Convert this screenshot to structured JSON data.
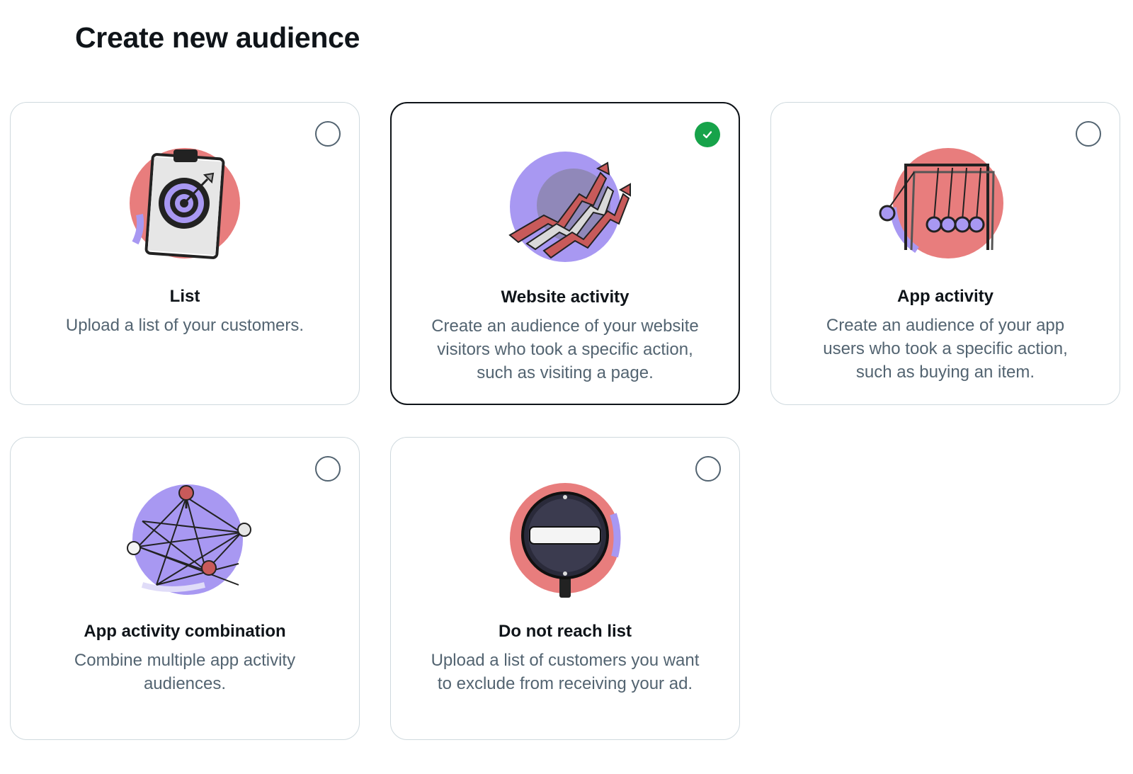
{
  "page": {
    "title": "Create new audience"
  },
  "colors": {
    "selected_check": "#17a34a",
    "illustration_pink": "#e87d7d",
    "illustration_purple": "#a898f2"
  },
  "options": [
    {
      "title": "List",
      "description": "Upload a list of your customers.",
      "icon": "clipboard-target-icon",
      "selected": false
    },
    {
      "title": "Website activity",
      "description": "Create an audience of your website visitors who took a specific action, such as visiting a page.",
      "icon": "rising-arrows-globe-icon",
      "selected": true
    },
    {
      "title": "App activity",
      "description": "Create an audience of your app users who took a specific action, such as buying an item.",
      "icon": "newtons-cradle-icon",
      "selected": false
    },
    {
      "title": "App activity combination",
      "description": "Combine multiple app activity audiences.",
      "icon": "pushpin-network-icon",
      "selected": false
    },
    {
      "title": "Do not reach list",
      "description": "Upload a list of customers you want to exclude from receiving your ad.",
      "icon": "no-entry-sign-icon",
      "selected": false
    }
  ]
}
